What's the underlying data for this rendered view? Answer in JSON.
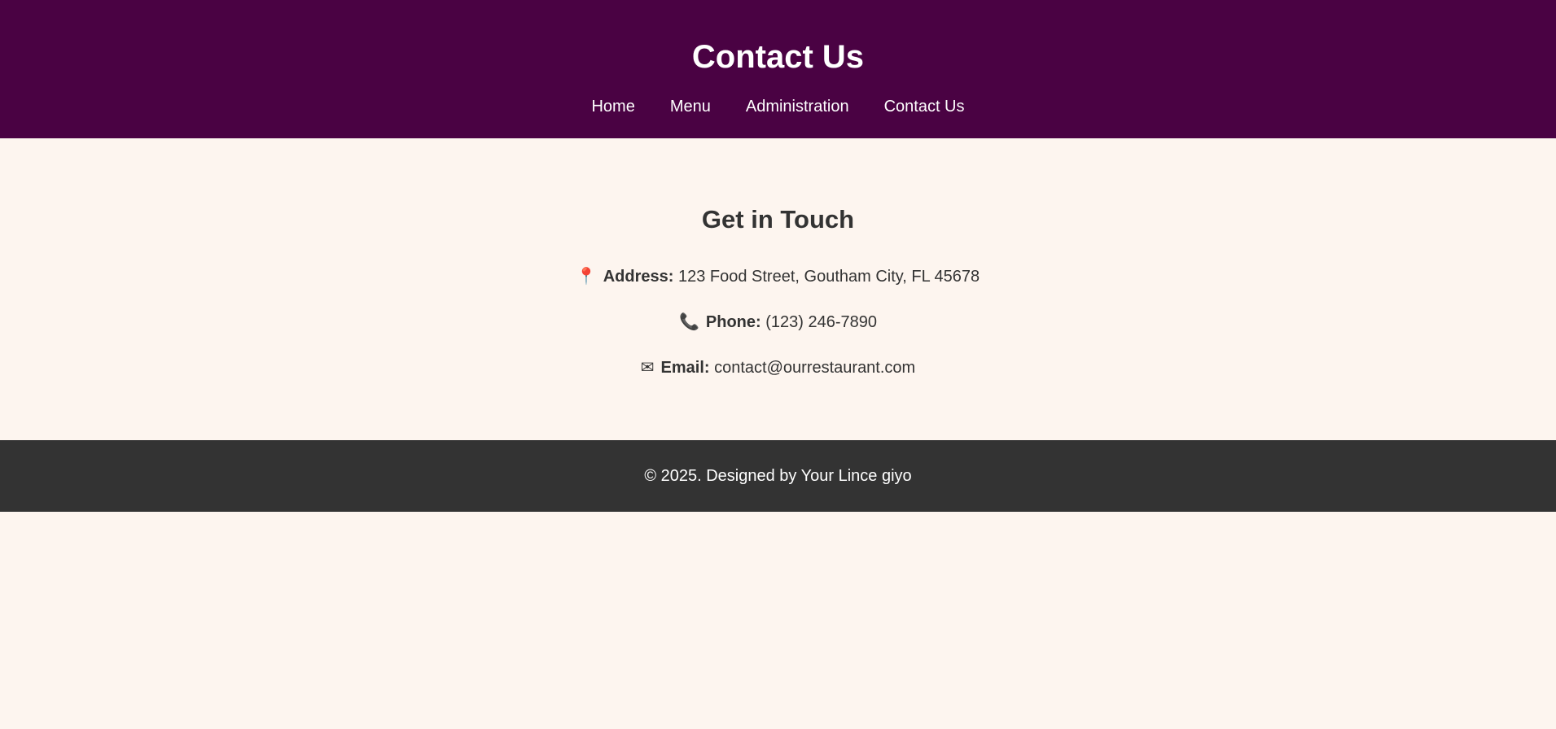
{
  "header": {
    "title": "Contact Us",
    "nav": [
      "Home",
      "Menu",
      "Administration",
      "Contact Us"
    ]
  },
  "main": {
    "heading": "Get in Touch",
    "items": [
      {
        "icon": "pushpin-icon",
        "glyph": "📍",
        "label": "Address:",
        "value": "123 Food Street, Goutham City, FL 45678"
      },
      {
        "icon": "phone-icon",
        "glyph": "📞",
        "label": "Phone:",
        "value": "(123) 246-7890"
      },
      {
        "icon": "envelope-icon",
        "glyph": "✉",
        "label": "Email:",
        "value": "contact@ourrestaurant.com"
      }
    ]
  },
  "footer": {
    "text": "© 2025. Designed by Your Lince giyo"
  },
  "colors": {
    "header_bg": "#4a0243",
    "page_bg": "#fdf5ef",
    "footer_bg": "#333333"
  }
}
